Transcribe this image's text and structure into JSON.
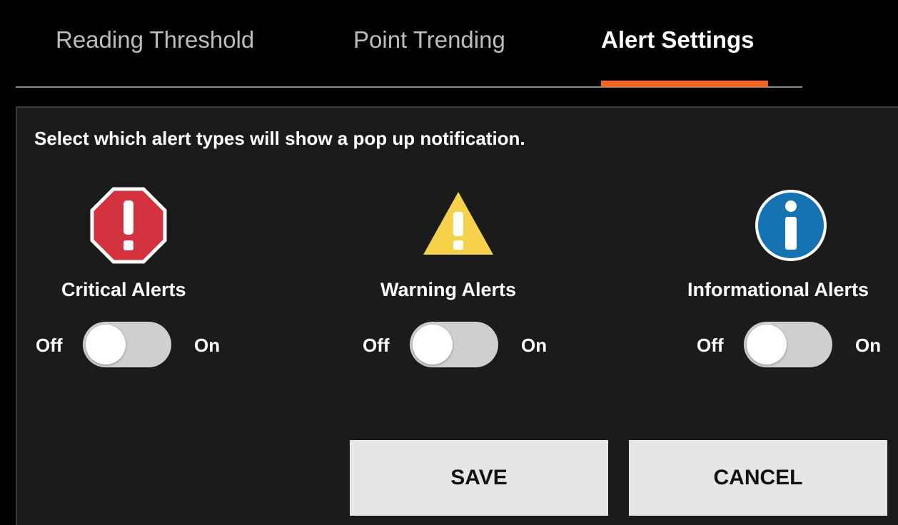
{
  "tabs": [
    {
      "label": "Reading Threshold",
      "active": false
    },
    {
      "label": "Point Trending",
      "active": false
    },
    {
      "label": "Alert Settings",
      "active": true
    }
  ],
  "colors": {
    "background": "#000000",
    "panel": "#1b1b1b",
    "accent": "#f26522",
    "critical": "#d1323e",
    "warning": "#f6d24a",
    "info": "#1473b0",
    "toggle_track": "#cfcfcf",
    "button_bg": "#e6e6e6"
  },
  "panel": {
    "instruction": "Select which alert types will show a pop up notification."
  },
  "alerts": [
    {
      "label": "Critical Alerts",
      "icon": "critical-octagon-icon",
      "off_label": "Off",
      "on_label": "On",
      "enabled": false
    },
    {
      "label": "Warning Alerts",
      "icon": "warning-triangle-icon",
      "off_label": "Off",
      "on_label": "On",
      "enabled": false
    },
    {
      "label": "Informational Alerts",
      "icon": "info-circle-icon",
      "off_label": "Off",
      "on_label": "On",
      "enabled": false
    }
  ],
  "buttons": {
    "save": "SAVE",
    "cancel": "CANCEL"
  }
}
